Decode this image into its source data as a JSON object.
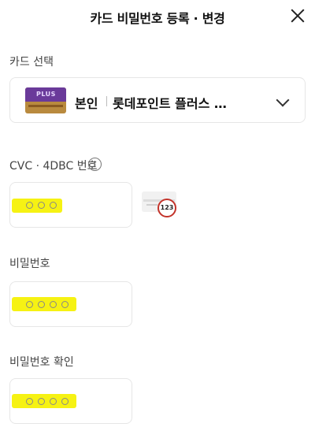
{
  "header": {
    "title": "카드 비밀번호 등록 · 변경",
    "close_icon": "close-icon"
  },
  "card_section": {
    "label": "카드 선택",
    "selected_owner": "본인",
    "selected_card": "롯데포인트 플러스 …",
    "card_image_text": "PLUS",
    "chevron_icon": "chevron-down-icon"
  },
  "cvc_section": {
    "label": "CVC · 4DBC 번호",
    "info_icon_text": "i",
    "dots": 3,
    "hint_number": "123"
  },
  "password_section": {
    "label": "비밀번호",
    "dots": 4
  },
  "confirm_section": {
    "label": "비밀번호 확인",
    "dots": 4
  },
  "colors": {
    "highlight": "#f6f213",
    "card_band": "#6a3a9a",
    "hint_ring": "#c3332a"
  }
}
